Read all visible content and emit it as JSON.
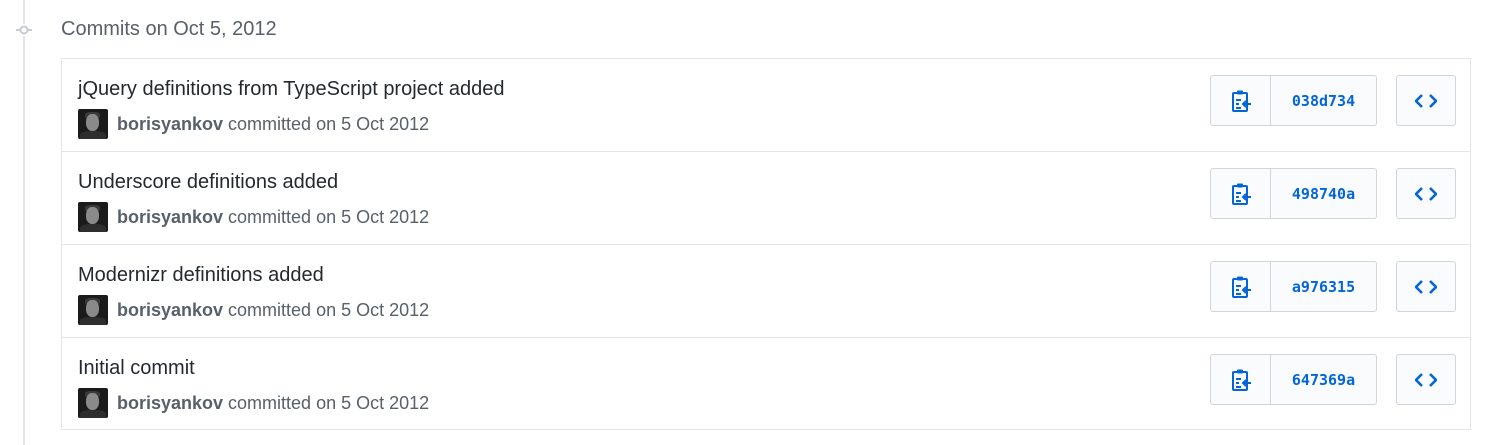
{
  "group": {
    "title": "Commits on Oct 5, 2012"
  },
  "colors": {
    "accent": "#0366d6",
    "text": "#24292e",
    "muted": "#586069",
    "border": "#e1e4e8"
  },
  "icons": {
    "timeline": "commit-node-icon",
    "copy": "clipboard-icon",
    "browse": "code-icon"
  },
  "commits": [
    {
      "title": "jQuery definitions from TypeScript project added",
      "author": "borisyankov",
      "committed": "committed on 5 Oct 2012",
      "sha": "038d734"
    },
    {
      "title": "Underscore definitions added",
      "author": "borisyankov",
      "committed": "committed on 5 Oct 2012",
      "sha": "498740a"
    },
    {
      "title": "Modernizr definitions added",
      "author": "borisyankov",
      "committed": "committed on 5 Oct 2012",
      "sha": "a976315"
    },
    {
      "title": "Initial commit",
      "author": "borisyankov",
      "committed": "committed on 5 Oct 2012",
      "sha": "647369a"
    }
  ]
}
